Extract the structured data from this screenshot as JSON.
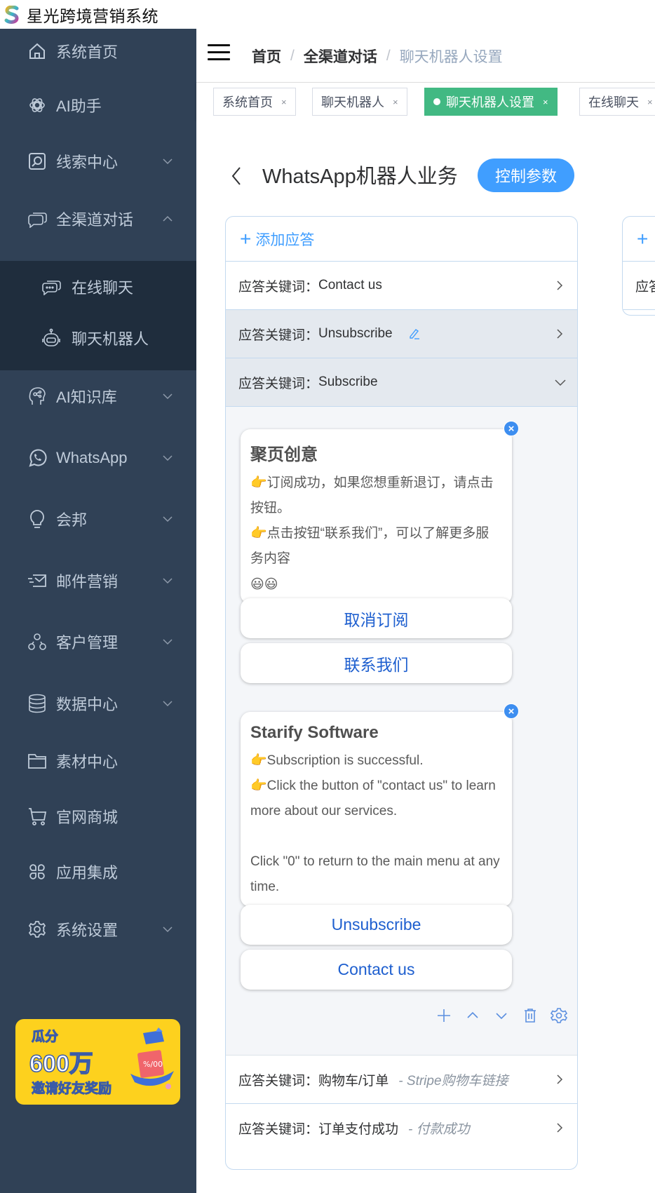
{
  "app": {
    "title": "星光跨境营销系统"
  },
  "sidebar": {
    "items": [
      {
        "label": "系统首页",
        "icon": "home-icon",
        "has_chevron": false
      },
      {
        "label": "AI助手",
        "icon": "ai-assistant-icon",
        "has_chevron": false
      },
      {
        "label": "线索中心",
        "icon": "search-box-icon",
        "has_chevron": true,
        "expanded": false
      },
      {
        "label": "全渠道对话",
        "icon": "chat-bubbles-icon",
        "has_chevron": true,
        "expanded": true
      },
      {
        "label": "AI知识库",
        "icon": "brain-head-icon",
        "has_chevron": true,
        "expanded": false
      },
      {
        "label": "WhatsApp",
        "icon": "whatsapp-icon",
        "has_chevron": true,
        "expanded": false
      },
      {
        "label": "会邦",
        "icon": "lightbulb-icon",
        "has_chevron": true,
        "expanded": false
      },
      {
        "label": "邮件营销",
        "icon": "mail-send-icon",
        "has_chevron": true,
        "expanded": false
      },
      {
        "label": "客户管理",
        "icon": "customers-icon",
        "has_chevron": true,
        "expanded": false
      },
      {
        "label": "数据中心",
        "icon": "database-icon",
        "has_chevron": true,
        "expanded": false
      },
      {
        "label": "素材中心",
        "icon": "folder-icon",
        "has_chevron": false
      },
      {
        "label": "官网商城",
        "icon": "cart-icon",
        "has_chevron": false
      },
      {
        "label": "应用集成",
        "icon": "apps-icon",
        "has_chevron": false
      },
      {
        "label": "系统设置",
        "icon": "gear-icon",
        "has_chevron": true,
        "expanded": false
      }
    ],
    "submenu": [
      {
        "label": "在线聊天",
        "icon": "chat-icon"
      },
      {
        "label": "聊天机器人",
        "icon": "robot-icon"
      }
    ],
    "promo": {
      "line1": "瓜分",
      "line2": "600万",
      "line3": "邀请好友奖励"
    }
  },
  "header": {
    "breadcrumb": [
      "首页",
      "全渠道对话",
      "聊天机器人设置"
    ],
    "separator": "/"
  },
  "tags": [
    {
      "label": "系统首页",
      "active": false
    },
    {
      "label": "聊天机器人",
      "active": false
    },
    {
      "label": "聊天机器人设置",
      "active": true
    },
    {
      "label": "在线聊天",
      "active": false
    }
  ],
  "tag_close": "×",
  "main": {
    "title": "WhatsApp机器人业务",
    "control_button": "控制参数",
    "add_response": "添加应答",
    "keyword_prefix": "应答关键词：",
    "keywords": [
      {
        "keyword": "Contact us",
        "subtitle": "",
        "state": "collapsed"
      },
      {
        "keyword": "Unsubscribe",
        "subtitle": "",
        "state": "hover",
        "editable": true
      },
      {
        "keyword": "Subscribe",
        "subtitle": "",
        "state": "expanded"
      },
      {
        "keyword": "购物车/订单",
        "subtitle": "- Stripe购物车链接",
        "state": "collapsed"
      },
      {
        "keyword": "订单支付成功",
        "subtitle": "- 付款成功",
        "state": "collapsed"
      }
    ],
    "second_panel": {
      "add_plus": "+",
      "keyword_partial": "应答"
    },
    "expanded_content": {
      "messages": [
        {
          "title": "聚页创意",
          "lines": [
            "👉订阅成功，如果您想重新退订，请点击按钮。",
            "👉点击按钮“联系我们”，可以了解更多服务内容",
            "😃😃"
          ],
          "buttons": [
            "取消订阅",
            "联系我们"
          ]
        },
        {
          "title": "Starify Software",
          "lines": [
            "👉Subscription is successful.",
            "👉Click the button of \"contact us\" to learn more about our services.",
            "",
            "Click \"0\" to return to the main menu at any time."
          ],
          "buttons": [
            "Unsubscribe",
            "Contact us"
          ]
        }
      ],
      "tools": [
        "add-icon",
        "move-up-icon",
        "move-down-icon",
        "trash-icon",
        "settings-icon"
      ]
    }
  },
  "colors": {
    "sidebar_bg": "#304156",
    "submenu_bg": "#1f2d3d",
    "sidebar_text": "#bfcbd9",
    "active_tag": "#42b983",
    "primary": "#409eff",
    "panel_border": "#c3d9ef",
    "button_text": "#1e5fcf",
    "promo_bg": "#fdd11e"
  }
}
